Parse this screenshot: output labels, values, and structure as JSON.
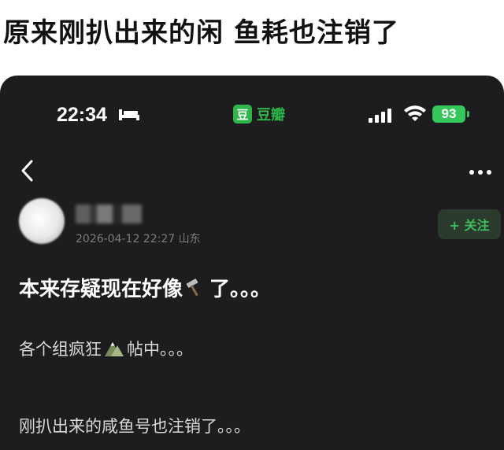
{
  "headline": "原来刚扒出来的闲 鱼耗也注销了",
  "status_bar": {
    "time": "22:34",
    "app_logo_char": "豆",
    "app_name": "豆瓣",
    "battery": "93"
  },
  "icons": {
    "sleep": "bed-icon",
    "signal": "cellular-signal-icon",
    "wifi": "wifi-icon",
    "back": "chevron-left-icon",
    "more": "more-dots-icon",
    "title_emoji": "hammer-icon",
    "body_emoji": "mountain-icon"
  },
  "post": {
    "meta": "2026-04-12 22:27  山东",
    "follow_label": "+ 关注",
    "title_before": "本来存疑现在好像",
    "title_after": "了。。。",
    "body1_before": "各个组疯狂",
    "body1_after": "帖中。。。",
    "body2": "刚扒出来的咸鱼号也注销了。。。"
  },
  "colors": {
    "background_dark": "#1d1d1f",
    "douban_green": "#2fb54a",
    "battery_green": "#34c759"
  }
}
